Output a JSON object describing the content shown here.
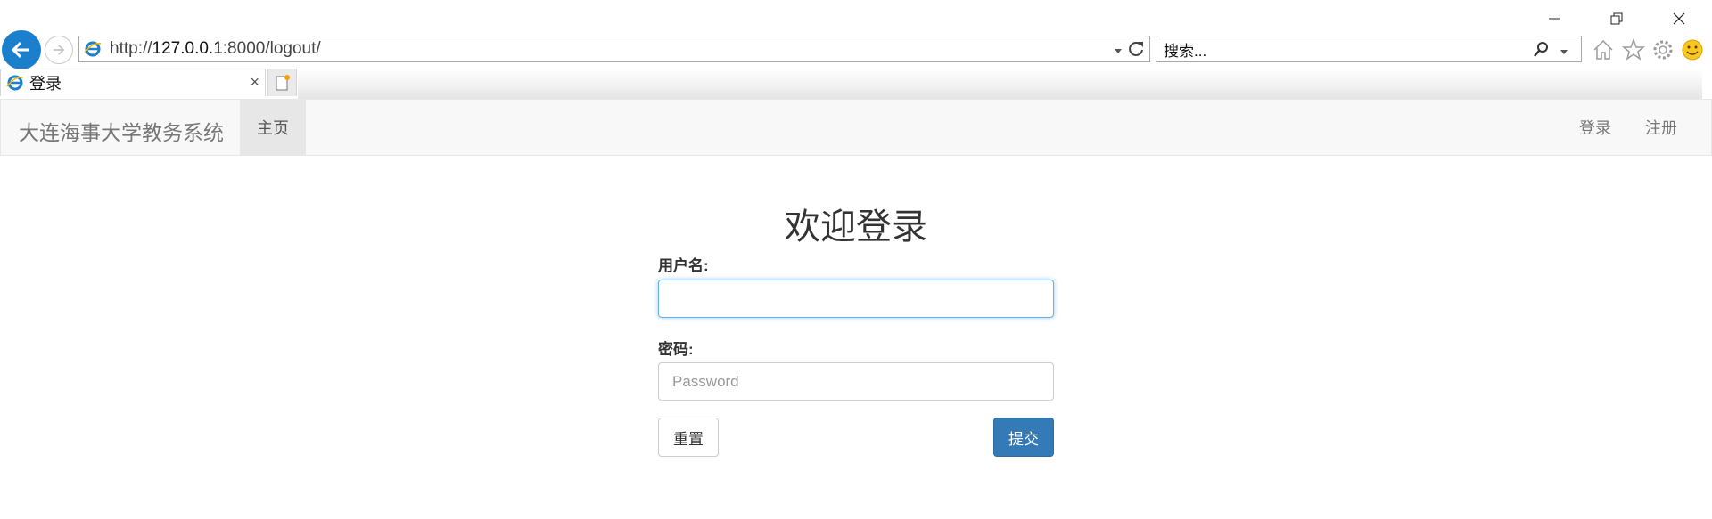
{
  "browser": {
    "url_prefix": "http://",
    "url_host": "127.0.0.1",
    "url_rest": ":8000/logout/",
    "search_placeholder": "搜索...",
    "tab_title": "登录",
    "tab_close": "×",
    "icons": [
      "back-arrow-icon",
      "forward-arrow-icon",
      "ie-logo-icon",
      "refresh-icon",
      "search-icon",
      "home-icon",
      "star-icon",
      "gear-icon",
      "smiley-icon"
    ]
  },
  "navbar": {
    "brand": "大连海事大学教务系统",
    "home": "主页",
    "login": "登录",
    "register": "注册"
  },
  "form": {
    "title": "欢迎登录",
    "username_label": "用户名:",
    "username_value": "",
    "password_label": "密码:",
    "password_placeholder": "Password",
    "reset_button": "重置",
    "submit_button": "提交"
  },
  "colors": {
    "back_button": "#1b7fcc",
    "primary_button": "#337ab7",
    "focus_border": "#66afe9",
    "navbar_bg": "#f8f8f8"
  }
}
